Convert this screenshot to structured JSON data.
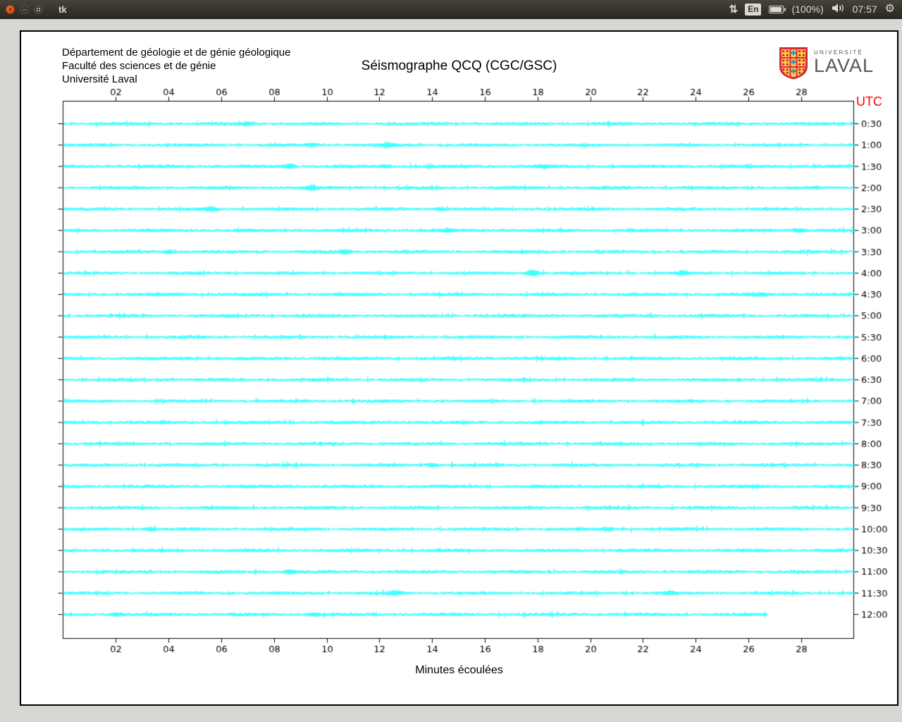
{
  "window": {
    "title": "tk"
  },
  "tray": {
    "keyboard": "En",
    "battery": "(100%)",
    "time": "07:57",
    "icon_names": [
      "sync-arrows-icon",
      "battery-icon",
      "volume-icon",
      "session-gear-icon"
    ]
  },
  "header": {
    "line1": "Département de géologie et de génie géologique",
    "line2": "Faculté des sciences et de génie",
    "line3": "Université Laval"
  },
  "logo": {
    "line1": "UNIVERSITÉ",
    "line2": "LAVAL"
  },
  "colors": {
    "trace": "#00ffff",
    "utc_label": "#ff0000",
    "titlebar": "#35322b",
    "close_button": "#dd4814",
    "workspace_bg": "#d9d7d3",
    "canvas_bg": "#ffffff",
    "axis": "#000000"
  },
  "chart_data": {
    "type": "line",
    "title": "Séismographe QCQ (CGC/GSC)",
    "xlabel": "Minutes écoulées",
    "utc_axis_label": "UTC",
    "x_range_minutes": [
      0,
      30
    ],
    "x_ticks": [
      "02",
      "04",
      "06",
      "08",
      "10",
      "12",
      "14",
      "16",
      "18",
      "20",
      "22",
      "24",
      "26",
      "28"
    ],
    "x_tick_values": [
      2,
      4,
      6,
      8,
      10,
      12,
      14,
      16,
      18,
      20,
      22,
      24,
      26,
      28
    ],
    "trace_color": "#00ffff",
    "minutes_per_row": 30,
    "traces": [
      {
        "utc": "0:30",
        "end_minute": 30,
        "bursts": [
          {
            "minute": 7.0,
            "amp": 1.5
          }
        ]
      },
      {
        "utc": "1:00",
        "end_minute": 30,
        "bursts": [
          {
            "minute": 9.4,
            "amp": 1.4
          },
          {
            "minute": 12.3,
            "amp": 1.8
          }
        ]
      },
      {
        "utc": "1:30",
        "end_minute": 30,
        "bursts": [
          {
            "minute": 8.6,
            "amp": 2.2
          },
          {
            "minute": 12.2,
            "amp": 1.3
          },
          {
            "minute": 18.2,
            "amp": 1.3
          }
        ]
      },
      {
        "utc": "2:00",
        "end_minute": 30,
        "bursts": [
          {
            "minute": 9.4,
            "amp": 1.5
          }
        ]
      },
      {
        "utc": "2:30",
        "end_minute": 30,
        "bursts": [
          {
            "minute": 5.6,
            "amp": 2.0
          },
          {
            "minute": 14.3,
            "amp": 1.3
          }
        ]
      },
      {
        "utc": "3:00",
        "end_minute": 30,
        "bursts": [
          {
            "minute": 14.6,
            "amp": 1.2
          },
          {
            "minute": 27.9,
            "amp": 2.0
          }
        ]
      },
      {
        "utc": "3:30",
        "end_minute": 30,
        "bursts": [
          {
            "minute": 4.0,
            "amp": 1.7
          },
          {
            "minute": 10.7,
            "amp": 2.0
          }
        ]
      },
      {
        "utc": "4:00",
        "end_minute": 30,
        "bursts": [
          {
            "minute": 17.8,
            "amp": 3.2
          },
          {
            "minute": 23.5,
            "amp": 1.4
          }
        ]
      },
      {
        "utc": "4:30",
        "end_minute": 30,
        "bursts": [
          {
            "minute": 26.5,
            "amp": 1.3
          }
        ]
      },
      {
        "utc": "5:00",
        "end_minute": 30,
        "bursts": []
      },
      {
        "utc": "5:30",
        "end_minute": 30,
        "bursts": []
      },
      {
        "utc": "6:00",
        "end_minute": 30,
        "bursts": []
      },
      {
        "utc": "6:30",
        "end_minute": 30,
        "bursts": []
      },
      {
        "utc": "7:00",
        "end_minute": 30,
        "bursts": []
      },
      {
        "utc": "7:30",
        "end_minute": 30,
        "bursts": []
      },
      {
        "utc": "8:00",
        "end_minute": 30,
        "bursts": []
      },
      {
        "utc": "8:30",
        "end_minute": 30,
        "bursts": [
          {
            "minute": 14.0,
            "amp": 1.7
          }
        ]
      },
      {
        "utc": "9:00",
        "end_minute": 30,
        "bursts": []
      },
      {
        "utc": "9:30",
        "end_minute": 30,
        "bursts": []
      },
      {
        "utc": "10:00",
        "end_minute": 30,
        "bursts": [
          {
            "minute": 3.3,
            "amp": 1.6
          },
          {
            "minute": 20.7,
            "amp": 1.2
          }
        ]
      },
      {
        "utc": "10:30",
        "end_minute": 30,
        "bursts": []
      },
      {
        "utc": "11:00",
        "end_minute": 30,
        "bursts": [
          {
            "minute": 8.6,
            "amp": 1.7
          }
        ]
      },
      {
        "utc": "11:30",
        "end_minute": 30,
        "bursts": [
          {
            "minute": 12.6,
            "amp": 1.8
          },
          {
            "minute": 23.0,
            "amp": 1.4
          }
        ]
      },
      {
        "utc": "12:00",
        "end_minute": 26.7,
        "bursts": [
          {
            "minute": 2.0,
            "amp": 1.4
          },
          {
            "minute": 9.5,
            "amp": 1.5
          }
        ]
      }
    ]
  }
}
